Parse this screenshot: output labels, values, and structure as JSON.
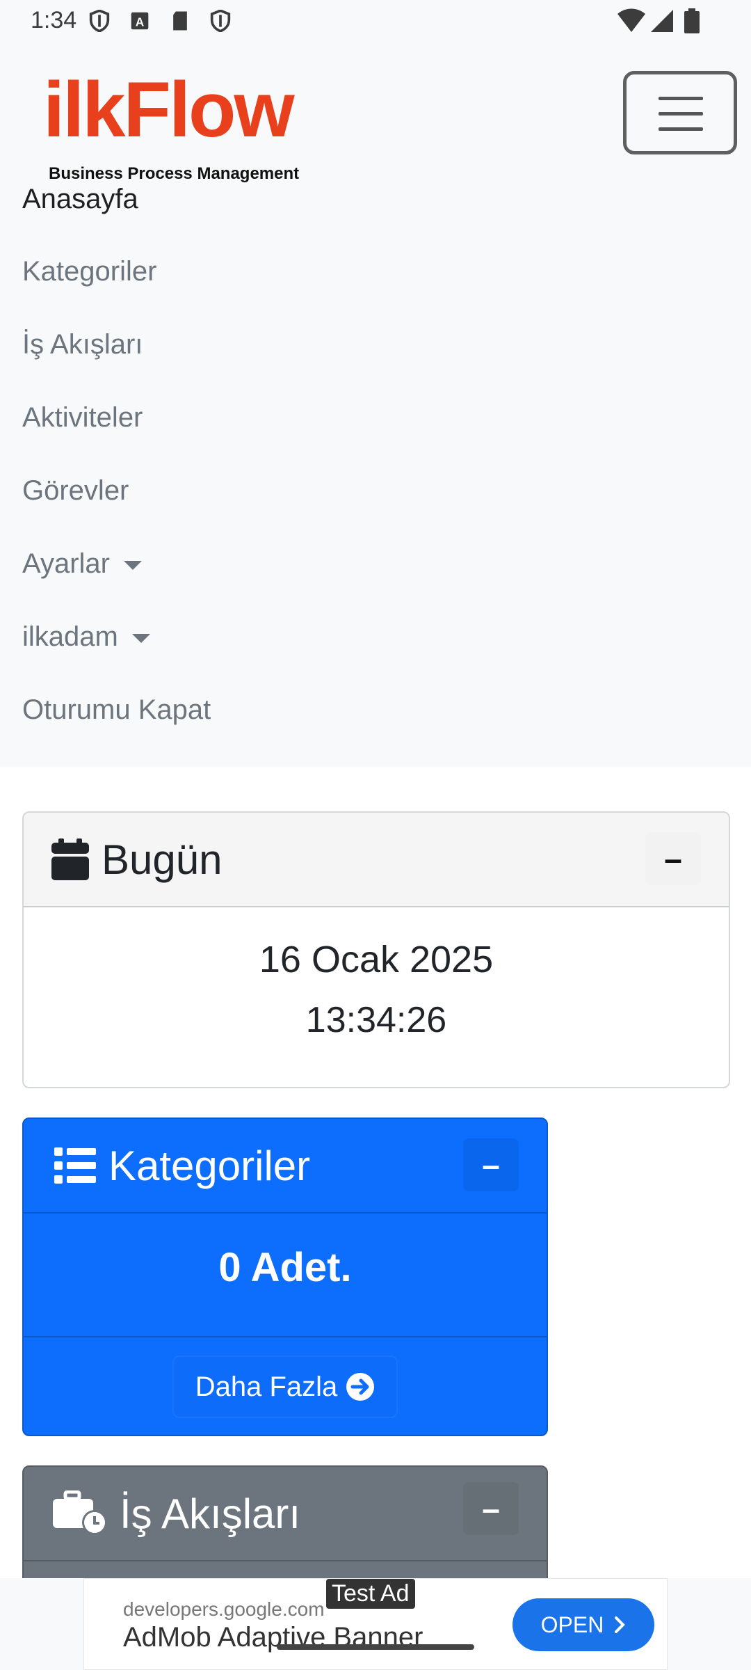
{
  "status_bar": {
    "time": "1:34",
    "left_icons": [
      "shield-icon",
      "font-a-icon",
      "sd-card-icon",
      "shield-icon"
    ],
    "right_icons": [
      "wifi-icon",
      "signal-icon",
      "battery-icon"
    ]
  },
  "navbar": {
    "brand": "ilkFlow",
    "brand_subtitle": "Business Process Management",
    "brand_color": "#e8401c",
    "items": [
      {
        "label": "Anasayfa",
        "active": true
      },
      {
        "label": "Kategoriler"
      },
      {
        "label": "İş Akışları"
      },
      {
        "label": "Aktiviteler"
      },
      {
        "label": "Görevler"
      },
      {
        "label": "Ayarlar",
        "dropdown": true
      },
      {
        "label": "ilkadam",
        "dropdown": true
      },
      {
        "label": "Oturumu Kapat"
      }
    ]
  },
  "today_card": {
    "title": "Bugün",
    "icon": "calendar-icon",
    "date": "16 Ocak 2025",
    "time": "13:34:26",
    "collapse_label": "–"
  },
  "categories_card": {
    "title": "Kategoriler",
    "icon": "list-icon",
    "count_text": "0 Adet.",
    "more_label": "Daha Fazla",
    "collapse_label": "–",
    "color": "#0d6efd"
  },
  "workflows_card": {
    "title": "İş Akışları",
    "icon": "briefcase-clock-icon",
    "collapse_label": "–",
    "color": "#6c757d"
  },
  "ad": {
    "badge": "Test Ad",
    "domain": "developers.google.com",
    "title": "AdMob Adaptive Banner",
    "cta": "OPEN"
  }
}
